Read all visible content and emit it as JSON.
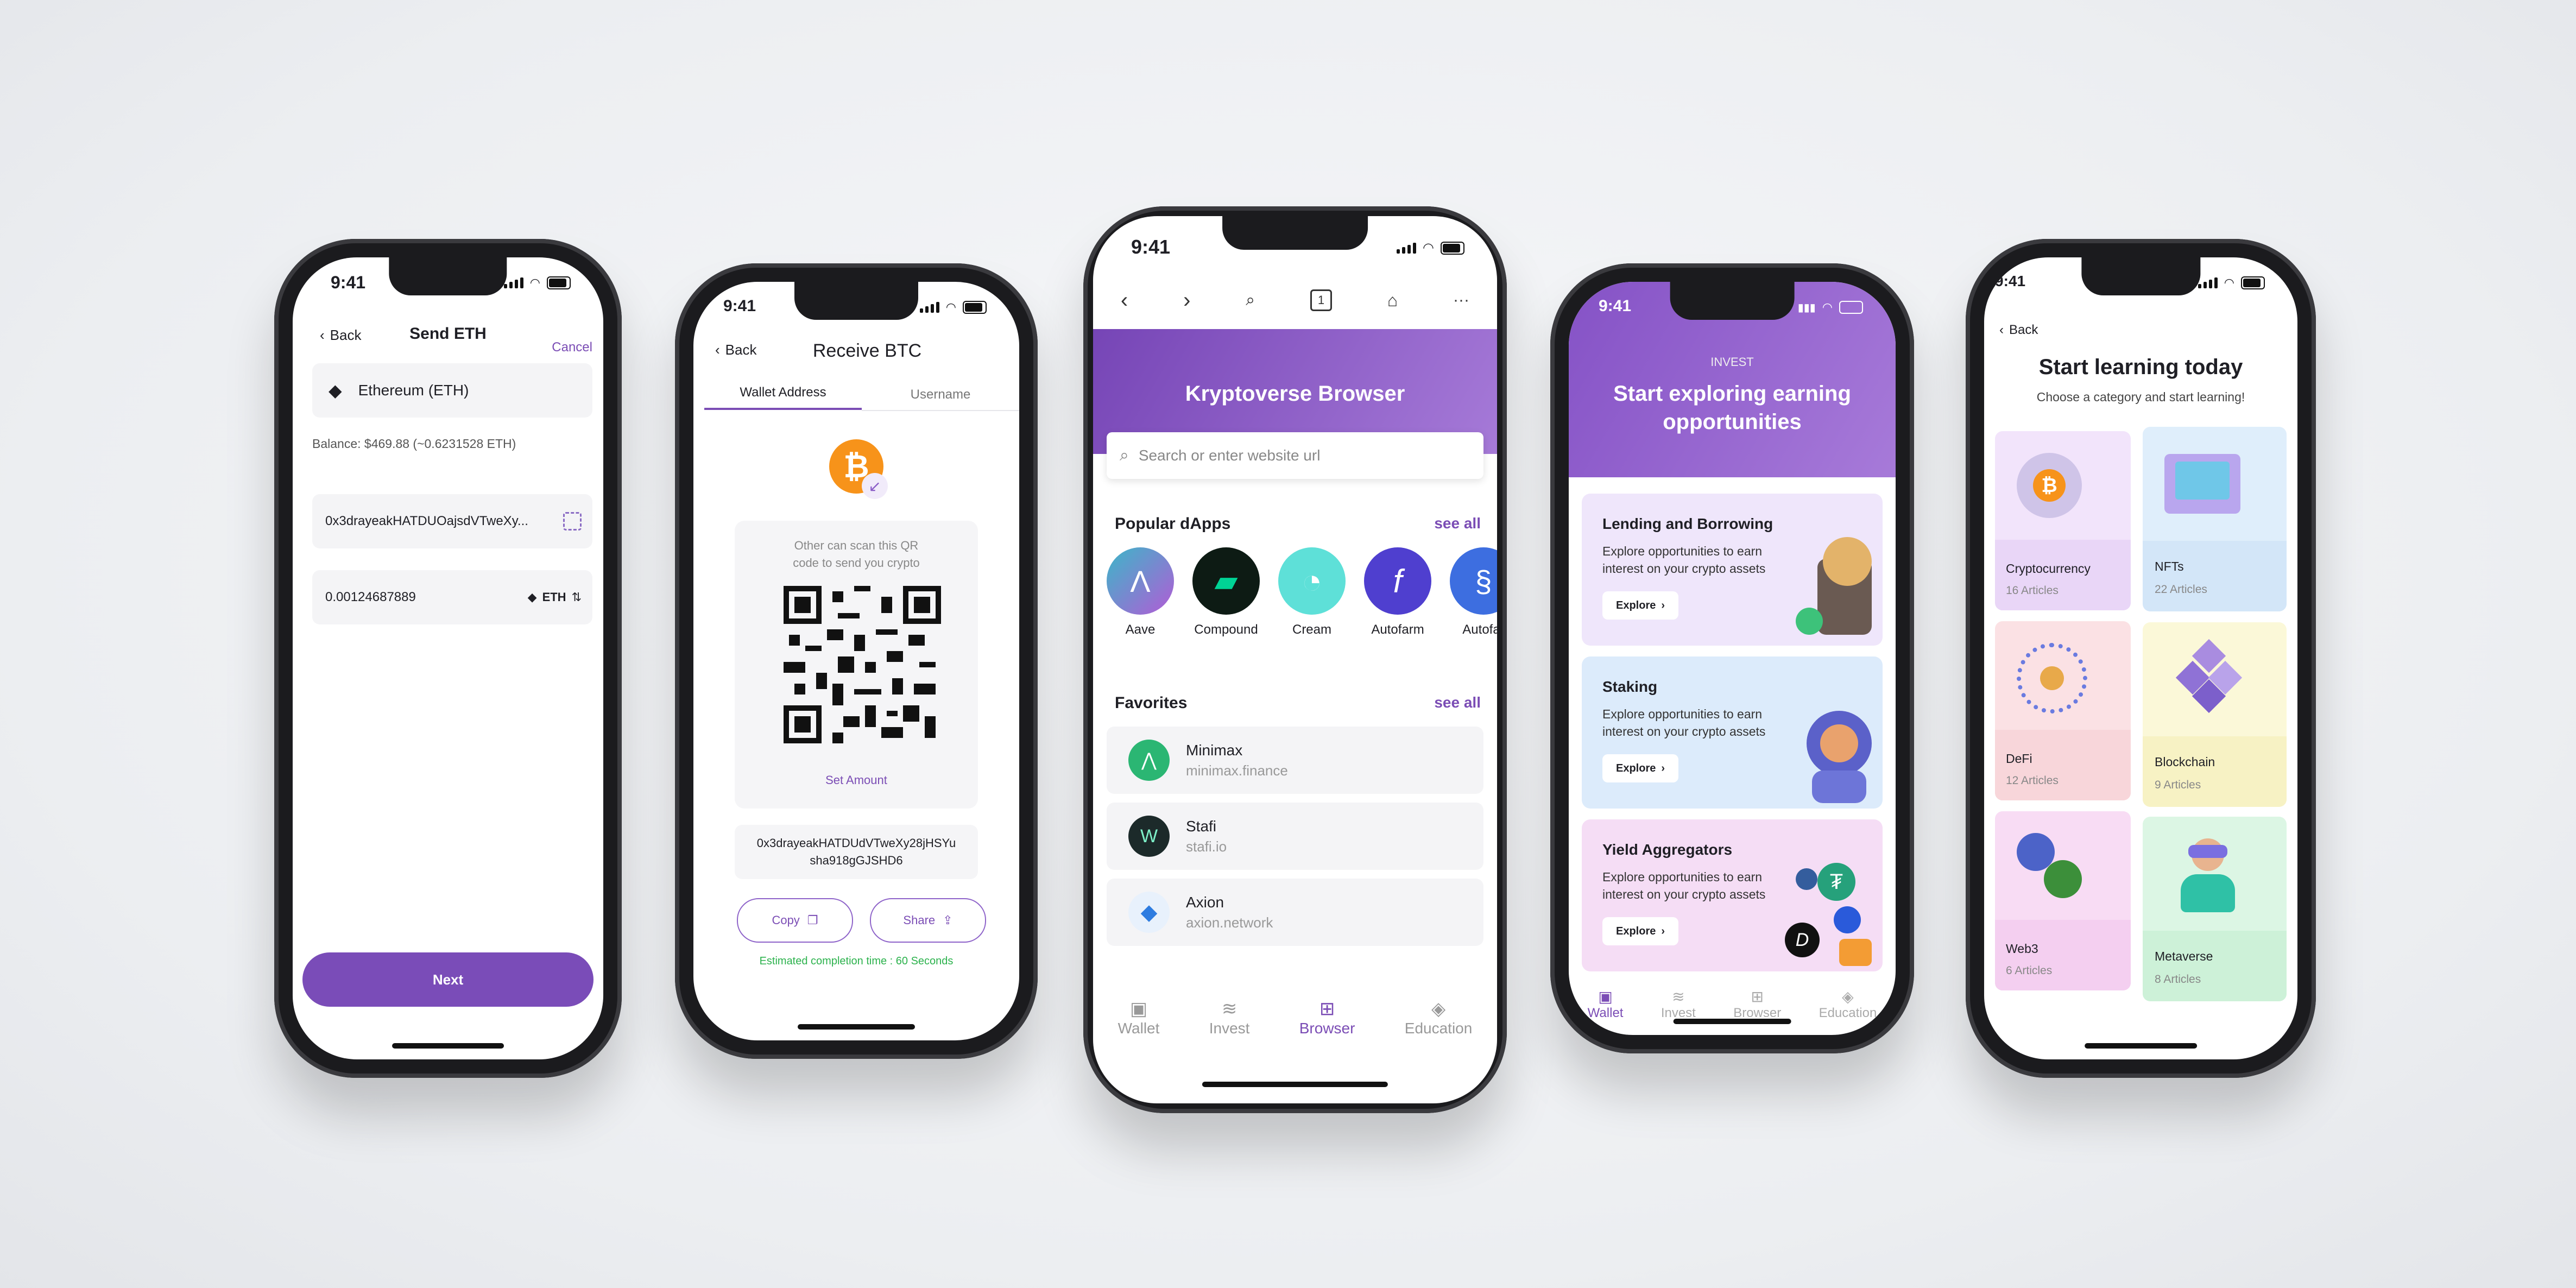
{
  "status_time": "9:41",
  "send": {
    "back": "Back",
    "title": "Send ETH",
    "cancel": "Cancel",
    "coin": "Ethereum (ETH)",
    "balance": "Balance: $469.88 (~0.6231528 ETH)",
    "address": "0x3drayeakHATDUOajsdVTweXy...",
    "amount": "0.00124687889",
    "unit": "ETH",
    "next": "Next"
  },
  "receive": {
    "back": "Back",
    "title": "Receive BTC",
    "tabs": [
      "Wallet Address",
      "Username"
    ],
    "qr_caption": "Other can scan this QR code to send you crypto",
    "set_amount": "Set Amount",
    "address": "0x3drayeakHATDUdVTweXy28jHSYu sha918gGJSHD6",
    "copy": "Copy",
    "share": "Share",
    "estimate": "Estimated completion time : 60 Seconds"
  },
  "browser": {
    "title": "Kryptoverse Browser",
    "search_placeholder": "Search or enter website url",
    "tab_count": "1",
    "popular_heading": "Popular dApps",
    "see_all": "see all",
    "dapps": [
      {
        "name": "Aave",
        "color": "#8f5bd6"
      },
      {
        "name": "Compound",
        "color": "#0d1b14"
      },
      {
        "name": "Cream",
        "color": "#5ee0d8"
      },
      {
        "name": "Autofarm",
        "color": "#4f3fcf"
      },
      {
        "name": "Autofar",
        "color": "#3d6ee0"
      }
    ],
    "favorites_heading": "Favorites",
    "favorites": [
      {
        "name": "Minimax",
        "url": "minimax.finance"
      },
      {
        "name": "Stafi",
        "url": "stafi.io"
      },
      {
        "name": "Axion",
        "url": "axion.network"
      }
    ],
    "nav": [
      "Wallet",
      "Invest",
      "Browser",
      "Education"
    ]
  },
  "invest": {
    "eyebrow": "INVEST",
    "headline": "Start exploring earning opportunities",
    "cards": [
      {
        "title": "Lending and Borrowing",
        "desc": "Explore opportunities to earn interest on your crypto assets",
        "cta": "Explore",
        "color": "#efe6fb"
      },
      {
        "title": "Staking",
        "desc": "Explore opportunities to earn interest on your crypto assets",
        "cta": "Explore",
        "color": "#dcebfb"
      },
      {
        "title": "Yield Aggregators",
        "desc": "Explore opportunities to earn interest on your crypto assets",
        "cta": "Explore",
        "color": "#f5ddf5"
      }
    ],
    "nav": [
      "Wallet",
      "Invest",
      "Browser",
      "Education"
    ]
  },
  "learn": {
    "back": "Back",
    "title": "Start learning today",
    "subtitle": "Choose a category and start learning!",
    "categories": [
      {
        "name": "Cryptocurrency",
        "count": "16 Articles",
        "color": "#f2e4fb"
      },
      {
        "name": "NFTs",
        "count": "22 Articles",
        "color": "#dfeefb"
      },
      {
        "name": "DeFi",
        "count": "12 Articles",
        "color": "#fbe1e4"
      },
      {
        "name": "Blockchain",
        "count": "9 Articles",
        "color": "#fbf8d8"
      },
      {
        "name": "Web3",
        "count": "6 Articles",
        "color": "#f8dcf4"
      },
      {
        "name": "Metaverse",
        "count": "8 Articles",
        "color": "#dcf6e4"
      }
    ]
  }
}
